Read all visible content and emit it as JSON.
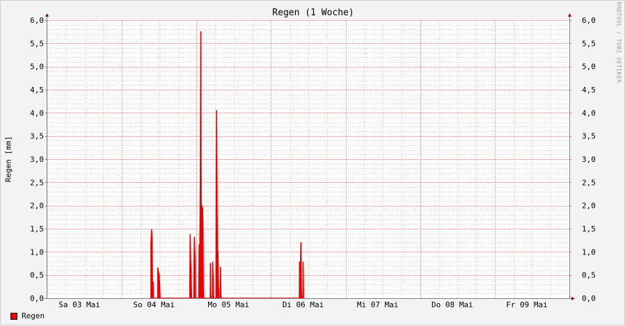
{
  "chart_data": {
    "type": "area",
    "title": "Regen (1 Woche)",
    "ylabel": "Regen [mm]",
    "xlabel": "",
    "ylim": [
      0,
      6.0
    ],
    "xlim": [
      0,
      7.0
    ],
    "x_unit": "days since start of Sa 03 Mai (approx. 1 day before first tick)",
    "yticks": [
      "0,0",
      "0,5",
      "1,0",
      "1,5",
      "2,0",
      "2,5",
      "3,0",
      "3,5",
      "4,0",
      "4,5",
      "5,0",
      "5,5",
      "6,0"
    ],
    "xticks": [
      {
        "label": "Sa 03 Mai",
        "x": 0.43
      },
      {
        "label": "So 04 Mai",
        "x": 1.43
      },
      {
        "label": "Mo 05 Mai",
        "x": 2.43
      },
      {
        "label": "Di 06 Mai",
        "x": 3.43
      },
      {
        "label": "Mi 07 Mai",
        "x": 4.43
      },
      {
        "label": "Do 08 Mai",
        "x": 5.43
      },
      {
        "label": "Fr 09 Mai",
        "x": 6.43
      }
    ],
    "grid": true,
    "series": [
      {
        "name": "Regen",
        "color": "#ee0000",
        "points": [
          [
            1.39,
            0.0
          ],
          [
            1.39,
            1.15
          ],
          [
            1.397,
            1.48
          ],
          [
            1.404,
            1.3
          ],
          [
            1.41,
            0.35
          ],
          [
            1.418,
            0.35
          ],
          [
            1.422,
            0.0
          ],
          [
            1.48,
            0.0
          ],
          [
            1.482,
            0.65
          ],
          [
            1.49,
            0.55
          ],
          [
            1.5,
            0.5
          ],
          [
            1.507,
            0.25
          ],
          [
            1.512,
            0.0
          ],
          [
            1.91,
            0.0
          ],
          [
            1.912,
            0.55
          ],
          [
            1.916,
            1.38
          ],
          [
            1.922,
            0.8
          ],
          [
            1.928,
            0.45
          ],
          [
            1.935,
            0.0
          ],
          [
            1.965,
            0.0
          ],
          [
            1.967,
            0.6
          ],
          [
            1.972,
            1.32
          ],
          [
            1.98,
            0.85
          ],
          [
            1.987,
            0.0
          ],
          [
            2.03,
            0.0
          ],
          [
            2.032,
            0.3
          ],
          [
            2.036,
            1.15
          ],
          [
            2.042,
            0.65
          ],
          [
            2.047,
            1.45
          ],
          [
            2.052,
            2.7
          ],
          [
            2.058,
            5.75
          ],
          [
            2.063,
            2.05
          ],
          [
            2.068,
            0.6
          ],
          [
            2.072,
            2.0
          ],
          [
            2.077,
            1.2
          ],
          [
            2.082,
            1.95
          ],
          [
            2.087,
            1.5
          ],
          [
            2.092,
            0.2
          ],
          [
            2.098,
            0.0
          ],
          [
            2.185,
            0.0
          ],
          [
            2.187,
            0.75
          ],
          [
            2.193,
            0.1
          ],
          [
            2.198,
            0.0
          ],
          [
            2.215,
            0.0
          ],
          [
            2.217,
            0.78
          ],
          [
            2.224,
            0.4
          ],
          [
            2.23,
            0.0
          ],
          [
            2.262,
            0.0
          ],
          [
            2.264,
            1.8
          ],
          [
            2.27,
            4.05
          ],
          [
            2.276,
            2.0
          ],
          [
            2.282,
            0.8
          ],
          [
            2.288,
            1.02
          ],
          [
            2.294,
            0.3
          ],
          [
            2.3,
            0.05
          ],
          [
            2.306,
            0.0
          ],
          [
            2.32,
            0.0
          ],
          [
            2.322,
            0.67
          ],
          [
            2.328,
            0.0
          ],
          [
            3.38,
            0.0
          ],
          [
            3.382,
            0.78
          ],
          [
            3.388,
            0.2
          ],
          [
            3.394,
            0.65
          ],
          [
            3.4,
            1.2
          ],
          [
            3.406,
            0.2
          ],
          [
            3.412,
            0.0
          ],
          [
            3.428,
            0.0
          ],
          [
            3.43,
            0.78
          ],
          [
            3.436,
            0.0
          ]
        ]
      }
    ]
  },
  "legend": {
    "label": "Regen",
    "color": "#ee0000"
  },
  "watermark": "RRDTOOL / TOBI OETIKER"
}
